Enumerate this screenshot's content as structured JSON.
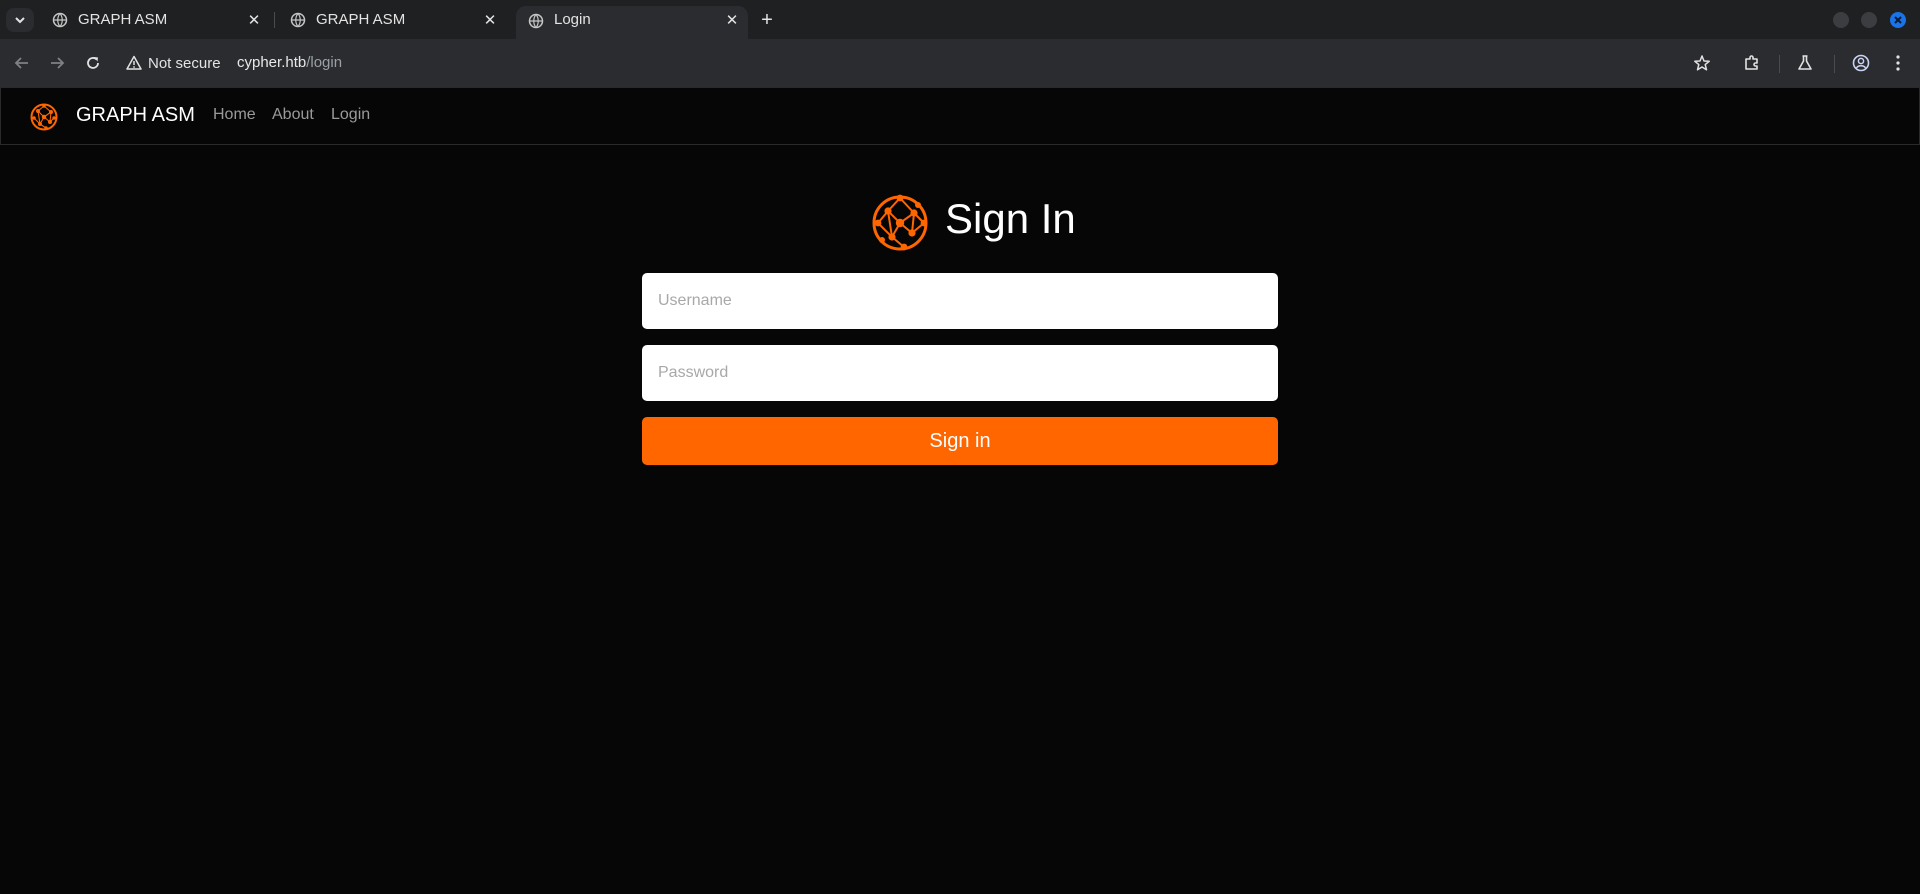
{
  "browser": {
    "tabs": [
      {
        "title": "GRAPH ASM",
        "active": false
      },
      {
        "title": "GRAPH ASM",
        "active": false
      },
      {
        "title": "Login",
        "active": true
      }
    ],
    "security_label": "Not secure",
    "url_host": "cypher.htb",
    "url_path": "/login"
  },
  "site": {
    "brand": "GRAPH ASM",
    "nav": {
      "home": "Home",
      "about": "About",
      "login": "Login"
    }
  },
  "form": {
    "title": "Sign In",
    "username_placeholder": "Username",
    "password_placeholder": "Password",
    "submit_label": "Sign in"
  },
  "colors": {
    "accent": "#ff6600",
    "page_bg": "#060606",
    "chrome_bg": "#2b2c2f"
  },
  "icons": [
    "chevron-down-icon",
    "globe-icon",
    "close-icon",
    "plus-icon",
    "back-arrow-icon",
    "forward-arrow-icon",
    "reload-icon",
    "warning-icon",
    "star-icon",
    "extensions-icon",
    "labs-flask-icon",
    "profile-icon",
    "kebab-menu-icon",
    "network-globe-icon"
  ]
}
